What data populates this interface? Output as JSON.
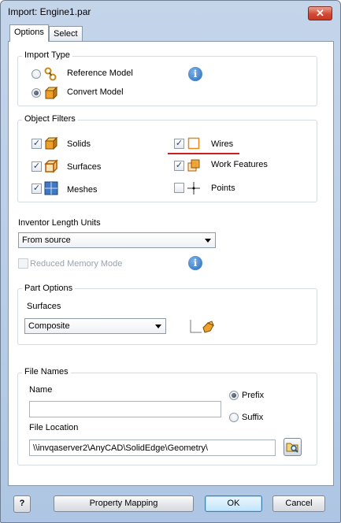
{
  "window": {
    "title": "Import:  Engine1.par",
    "close_glyph": "✕"
  },
  "tabs": [
    {
      "label": "Options"
    },
    {
      "label": "Select"
    }
  ],
  "import_type": {
    "label": "Import Type",
    "reference": {
      "label": "Reference Model",
      "selected": false,
      "icon": "reference-model-icon"
    },
    "convert": {
      "label": "Convert Model",
      "selected": true,
      "icon": "convert-model-icon"
    },
    "info_glyph": "i"
  },
  "object_filters": {
    "label": "Object Filters",
    "check_glyph": "✓",
    "items": [
      {
        "label": "Solids",
        "checked": true,
        "icon": "solid-cube-icon"
      },
      {
        "label": "Surfaces",
        "checked": true,
        "icon": "surface-cube-icon"
      },
      {
        "label": "Meshes",
        "checked": true,
        "icon": "mesh-grid-icon"
      },
      {
        "label": "Wires",
        "checked": true,
        "icon": "wire-square-icon"
      },
      {
        "label": "Work Features",
        "checked": true,
        "icon": "work-features-icon"
      },
      {
        "label": "Points",
        "checked": false,
        "icon": "point-crosshair-icon"
      }
    ],
    "highlight_color": "#cc1f1f"
  },
  "units": {
    "label": "Inventor Length Units",
    "selected": "From source"
  },
  "reduced_memory": {
    "label": "Reduced Memory Mode",
    "checked": false,
    "enabled": false
  },
  "part_options": {
    "label": "Part Options",
    "surfaces_label": "Surfaces",
    "surfaces_selected": "Composite",
    "icon": "composite-surface-icon"
  },
  "file_names": {
    "label": "File Names",
    "name_label": "Name",
    "name_value": "",
    "prefix_label": "Prefix",
    "prefix_selected": true,
    "suffix_label": "Suffix",
    "location_label": "File Location",
    "location_value": "\\\\invqaserver2\\AnyCAD\\SolidEdge\\Geometry\\",
    "browse_icon": "folder-browse-icon"
  },
  "footer": {
    "help_glyph": "?",
    "property_mapping": "Property Mapping",
    "ok": "OK",
    "cancel": "Cancel"
  },
  "colors": {
    "title_gradient": "#b7cde6",
    "accent_blue": "#2968b8",
    "cube_orange": "#f0a02a"
  }
}
